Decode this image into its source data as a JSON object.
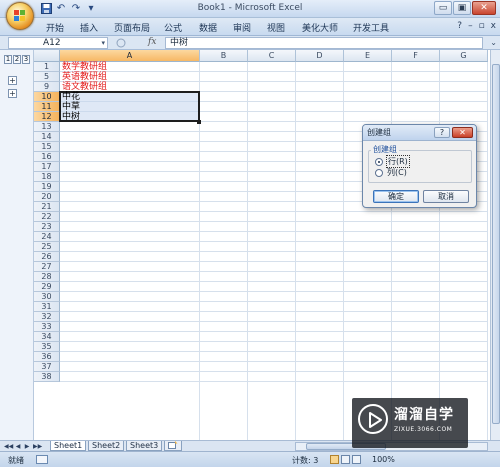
{
  "window": {
    "title": "Book1 - Microsoft Excel",
    "minimize_glyph": "▭",
    "restore_glyph": "▣",
    "close_glyph": "✕"
  },
  "quick_access": {
    "save_icon": "save-icon",
    "undo_glyph": "↶",
    "redo_glyph": "↷",
    "customize_glyph": "▾"
  },
  "ribbon": {
    "tabs": [
      "开始",
      "插入",
      "页面布局",
      "公式",
      "数据",
      "审阅",
      "视图",
      "美化大师",
      "开发工具"
    ],
    "right_glyphs": [
      "?",
      "–",
      "▫",
      "x"
    ]
  },
  "formula_bar": {
    "name_box": "A12",
    "dropdown_glyph": "▾",
    "fx_label": "fx",
    "formula": "中树",
    "expand_glyph": "⌄"
  },
  "outline": {
    "levels": [
      "1",
      "2",
      "3"
    ],
    "plus_glyph": "+"
  },
  "grid": {
    "columns": [
      "A",
      "B",
      "C",
      "D",
      "E",
      "F",
      "G"
    ],
    "selected_column": "A",
    "row_numbers": [
      "1",
      "5",
      "9",
      "10",
      "11",
      "12",
      "13",
      "14",
      "15",
      "16",
      "17",
      "18",
      "19",
      "20",
      "21",
      "22",
      "23",
      "24",
      "25",
      "26",
      "27",
      "28",
      "29",
      "30",
      "31",
      "32",
      "33",
      "34",
      "35",
      "36",
      "37",
      "38"
    ],
    "selected_rows": [
      "10",
      "11",
      "12"
    ],
    "cells": [
      {
        "row": "1",
        "text": "数学教研组",
        "color": "red"
      },
      {
        "row": "5",
        "text": "英语教研组",
        "color": "red"
      },
      {
        "row": "9",
        "text": "语文教研组",
        "color": "red"
      },
      {
        "row": "10",
        "text": "中花",
        "color": "black"
      },
      {
        "row": "11",
        "text": "中草",
        "color": "black"
      },
      {
        "row": "12",
        "text": "中树",
        "color": "black"
      }
    ]
  },
  "sheet_tabs": {
    "nav_glyphs": [
      "◀◀",
      "◀",
      "▶",
      "▶▶"
    ],
    "tabs": [
      "Sheet1",
      "Sheet2",
      "Sheet3"
    ],
    "active": "Sheet1",
    "insert_icon": "insert-sheet-icon"
  },
  "status_bar": {
    "ready": "就绪",
    "count": "计数: 3",
    "zoom": "100%"
  },
  "dialog": {
    "title": "创建组",
    "help_glyph": "?",
    "close_glyph": "✕",
    "group_label": "创建组",
    "options": [
      {
        "label": "行(R)",
        "selected": true
      },
      {
        "label": "列(C)",
        "selected": false
      }
    ],
    "ok": "确定",
    "cancel": "取消"
  },
  "watermark": {
    "name": "溜溜自学",
    "url": "ZIXUE.3066.COM"
  },
  "colors": {
    "accent_red": "#e41b1b",
    "header_selected": "#f7b865",
    "selection_fill": "#c5d6ef"
  }
}
